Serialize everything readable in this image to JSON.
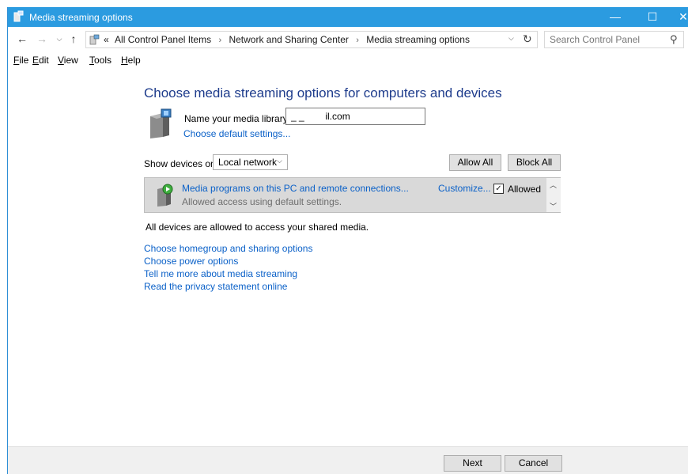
{
  "window": {
    "title": "Media streaming options",
    "controls": {
      "minimize": "—",
      "maximize": "☐",
      "close": "✕"
    }
  },
  "navigation": {
    "back_icon": "arrow-left-icon",
    "forward_icon": "arrow-right-icon",
    "recent_icon": "chevron-down-icon",
    "up_icon": "arrow-up-icon",
    "breadcrumb": {
      "overflow": "«",
      "items": [
        "All Control Panel Items",
        "Network and Sharing Center",
        "Media streaming options"
      ],
      "separator": "›"
    },
    "search": {
      "placeholder": "Search Control Panel"
    }
  },
  "menu": {
    "items": [
      {
        "underline": "F",
        "rest": "ile"
      },
      {
        "underline": "E",
        "rest": "dit"
      },
      {
        "underline": "V",
        "rest": "iew"
      },
      {
        "underline": "T",
        "rest": "ools"
      },
      {
        "underline": "H",
        "rest": "elp"
      }
    ]
  },
  "main": {
    "heading": "Choose media streaming options for computers and devices",
    "library_label": "Name your media library:",
    "library_value": "_ _        il.com",
    "default_settings_link": "Choose default settings...",
    "show_devices_label": "Show devices on:",
    "show_devices_value": "Local network",
    "allow_all": "Allow All",
    "block_all": "Block All",
    "device": {
      "name": "Media programs on this PC and remote connections...",
      "subtitle": "Allowed access using default settings.",
      "customize": "Customize...",
      "allowed_label": "Allowed",
      "allowed_checked": true
    },
    "status_text": "All devices are allowed to access your shared media.",
    "links": [
      "Choose homegroup and sharing options",
      "Choose power options",
      "Tell me more about media streaming",
      "Read the privacy statement online"
    ]
  },
  "footer": {
    "next": "Next",
    "cancel": "Cancel"
  },
  "colors": {
    "titlebar": "#2b9be0",
    "heading": "#1e3c8c",
    "link": "#0b61c8"
  }
}
